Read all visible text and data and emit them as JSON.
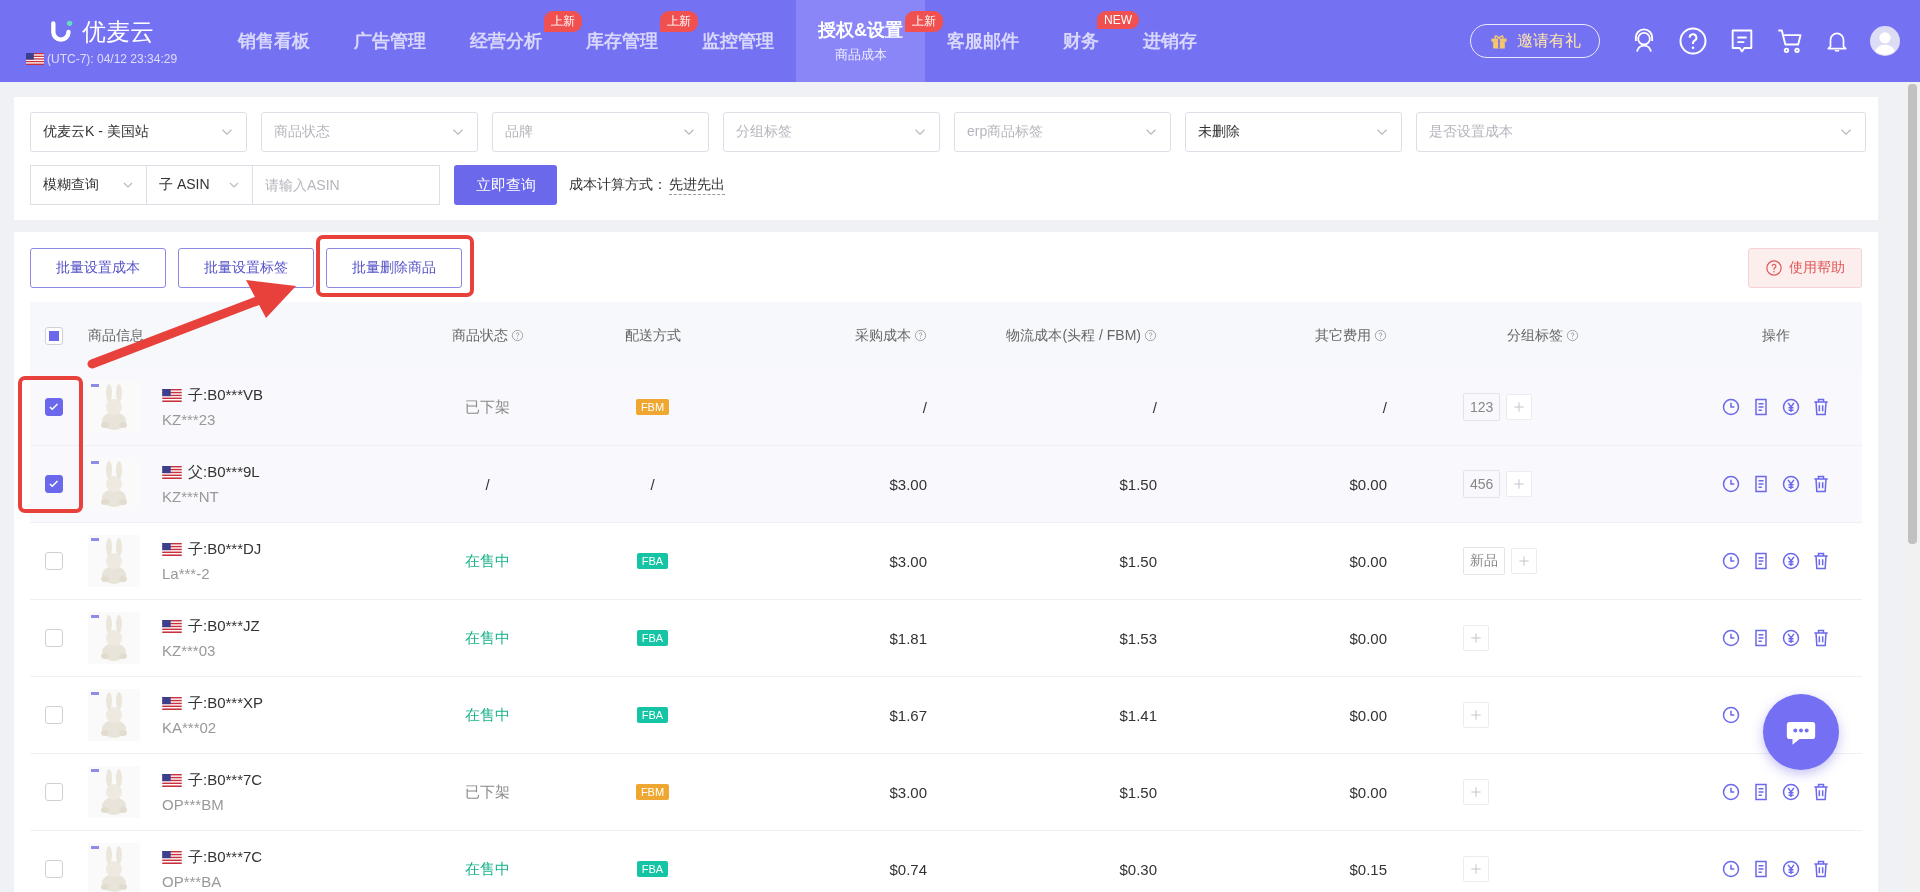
{
  "header": {
    "logo": "优麦云",
    "clock": "(UTC-7): 04/12 23:34:29",
    "nav": [
      {
        "label": "销售看板",
        "selected": false
      },
      {
        "label": "广告管理",
        "selected": false
      },
      {
        "label": "经营分析",
        "badge": "上新",
        "selected": false
      },
      {
        "label": "库存管理",
        "badge": "上新",
        "selected": false
      },
      {
        "label": "监控管理",
        "selected": false
      },
      {
        "label": "授权&设置",
        "badge": "上新",
        "sub": "商品成本",
        "selected": true
      },
      {
        "label": "客服邮件",
        "selected": false
      },
      {
        "label": "财务",
        "badge": "NEW",
        "selected": false
      },
      {
        "label": "进销存",
        "selected": false
      }
    ],
    "invite": "邀请有礼"
  },
  "filters": {
    "selects": [
      {
        "value": "优麦云K - 美国站"
      },
      {
        "placeholder": "商品状态"
      },
      {
        "placeholder": "品牌"
      },
      {
        "placeholder": "分组标签"
      },
      {
        "placeholder": "erp商品标签"
      },
      {
        "value": "未删除"
      },
      {
        "placeholder": "是否设置成本"
      }
    ],
    "search_mode": "模糊查询",
    "field_type": "子 ASIN",
    "asin": {
      "placeholder": "请输入ASIN"
    },
    "query_button": "立即查询",
    "cost_method_label": "成本计算方式：",
    "cost_method": "先进先出"
  },
  "toolbar": {
    "buttons": [
      "批量设置成本",
      "批量设置标签",
      "批量删除商品"
    ],
    "help": "使用帮助"
  },
  "table": {
    "select_all_partial": true,
    "columns": [
      {
        "label": "商品信息",
        "help": false
      },
      {
        "label": "商品状态",
        "help": true
      },
      {
        "label": "配送方式",
        "help": false
      },
      {
        "label": "采购成本",
        "help": true
      },
      {
        "label": "物流成本(头程 / FBM)",
        "help": true
      },
      {
        "label": "其它费用",
        "help": true
      },
      {
        "label": "分组标签",
        "help": true
      },
      {
        "label": "操作",
        "help": false
      }
    ],
    "rows": [
      {
        "checked": true,
        "asin": "子:B0***VB",
        "sku": "KZ***23",
        "status": {
          "text": "已下架",
          "kind": "off_shelf"
        },
        "shipping": {
          "text": "FBM",
          "kind": "fbm"
        },
        "purchase": "/",
        "logistics": "/",
        "other": "/",
        "tags": [
          "123"
        ]
      },
      {
        "checked": true,
        "asin": "父:B0***9L",
        "sku": "KZ***NT",
        "status": {
          "text": "/",
          "kind": "none"
        },
        "shipping": {
          "text": "/",
          "kind": "none"
        },
        "purchase": "$3.00",
        "logistics": "$1.50",
        "other": "$0.00",
        "tags": [
          "456"
        ]
      },
      {
        "checked": false,
        "asin": "子:B0***DJ",
        "sku": "La***-2",
        "status": {
          "text": "在售中",
          "kind": "on_sale"
        },
        "shipping": {
          "text": "FBA",
          "kind": "fba"
        },
        "purchase": "$3.00",
        "logistics": "$1.50",
        "other": "$0.00",
        "tags": [
          "新品"
        ]
      },
      {
        "checked": false,
        "asin": "子:B0***JZ",
        "sku": "KZ***03",
        "status": {
          "text": "在售中",
          "kind": "on_sale"
        },
        "shipping": {
          "text": "FBA",
          "kind": "fba"
        },
        "purchase": "$1.81",
        "logistics": "$1.53",
        "other": "$0.00"
      },
      {
        "checked": false,
        "asin": "子:B0***XP",
        "sku": "KA***02",
        "status": {
          "text": "在售中",
          "kind": "on_sale"
        },
        "shipping": {
          "text": "FBA",
          "kind": "fba"
        },
        "purchase": "$1.67",
        "logistics": "$1.41",
        "other": "$0.00"
      },
      {
        "checked": false,
        "asin": "子:B0***7C",
        "sku": "OP***BM",
        "status": {
          "text": "已下架",
          "kind": "off_shelf"
        },
        "shipping": {
          "text": "FBM",
          "kind": "fbm"
        },
        "purchase": "$3.00",
        "logistics": "$1.50",
        "other": "$0.00"
      },
      {
        "checked": false,
        "asin": "子:B0***7C",
        "sku": "OP***BA",
        "status": {
          "text": "在售中",
          "kind": "on_sale"
        },
        "shipping": {
          "text": "FBA",
          "kind": "fba"
        },
        "purchase": "$0.74",
        "logistics": "$0.30",
        "other": "$0.15"
      }
    ]
  }
}
